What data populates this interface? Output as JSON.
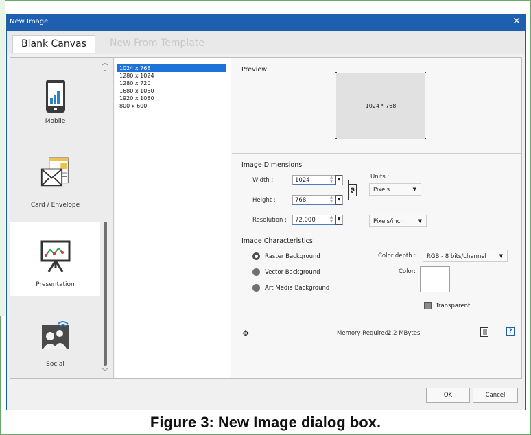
{
  "dialog": {
    "title": "New Image",
    "close_glyph": "✕"
  },
  "tabs": [
    "Blank Canvas",
    "New From Template"
  ],
  "categories": [
    {
      "label": "Mobile",
      "icon": "mobile-phone-icon"
    },
    {
      "label": "Card / Envelope",
      "icon": "envelope-card-icon"
    },
    {
      "label": "Presentation",
      "icon": "presentation-easel-icon",
      "selected": true
    },
    {
      "label": "Social",
      "icon": "social-people-icon"
    }
  ],
  "sizes": [
    "1024 x 768",
    "1280 x 1024",
    "1280 x 720",
    "1680 x 1050",
    "1920 x 1080",
    "800 x 600"
  ],
  "preview": {
    "heading": "Preview",
    "label": "1024 * 768"
  },
  "dimensions": {
    "heading": "Image Dimensions",
    "width_label": "Width :",
    "width_value": "1024",
    "height_label": "Height :",
    "height_value": "768",
    "resolution_label": "Resolution :",
    "resolution_value": "72.000",
    "units_label": "Units :",
    "units_value": "Pixels",
    "resolution_units": "Pixels/inch"
  },
  "characteristics": {
    "heading": "Image Characteristics",
    "options": [
      "Raster Background",
      "Vector Background",
      "Art Media Background"
    ],
    "selected_index": 0,
    "color_depth_label": "Color depth :",
    "color_depth_value": "RGB - 8 bits/channel",
    "color_label": "Color:",
    "transparent_label": "Transparent"
  },
  "memory": {
    "label": "Memory Required:",
    "value": "2.2 MBytes"
  },
  "buttons": {
    "ok": "OK",
    "cancel": "Cancel"
  },
  "caption": "Figure 3: New Image dialog box.",
  "colors": {
    "title_bar": "#1e5fb0",
    "selection": "#1e73d8"
  }
}
